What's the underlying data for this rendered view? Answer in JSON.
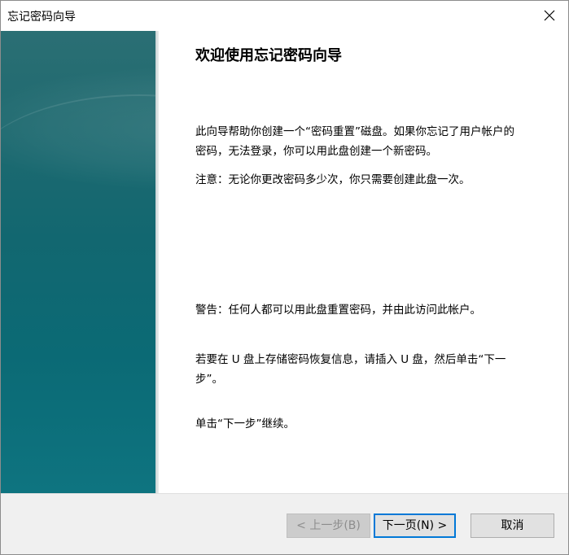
{
  "window": {
    "title": "忘记密码向导",
    "close_icon": "close-icon"
  },
  "content": {
    "heading": "欢迎使用忘记密码向导",
    "paragraph1": "此向导帮助你创建一个“密码重置”磁盘。如果你忘记了用户帐户的密码，无法登录，你可以用此盘创建一个新密码。",
    "paragraph2": "注意：无论你更改密码多少次，你只需要创建此盘一次。",
    "paragraph3": "警告：任何人都可以用此盘重置密码，并由此访问此帐户。",
    "paragraph4": "若要在 U 盘上存储密码恢复信息，请插入 U 盘，然后单击“下一步”。",
    "paragraph5": "单击“下一步”继续。"
  },
  "buttons": {
    "back_label": "< 上一步(B)",
    "next_label": "下一页(N) >",
    "cancel_label": "取消"
  },
  "colors": {
    "side_panel": "#126770",
    "focus_border": "#0078d7",
    "footer_bg": "#f0f0f0"
  }
}
